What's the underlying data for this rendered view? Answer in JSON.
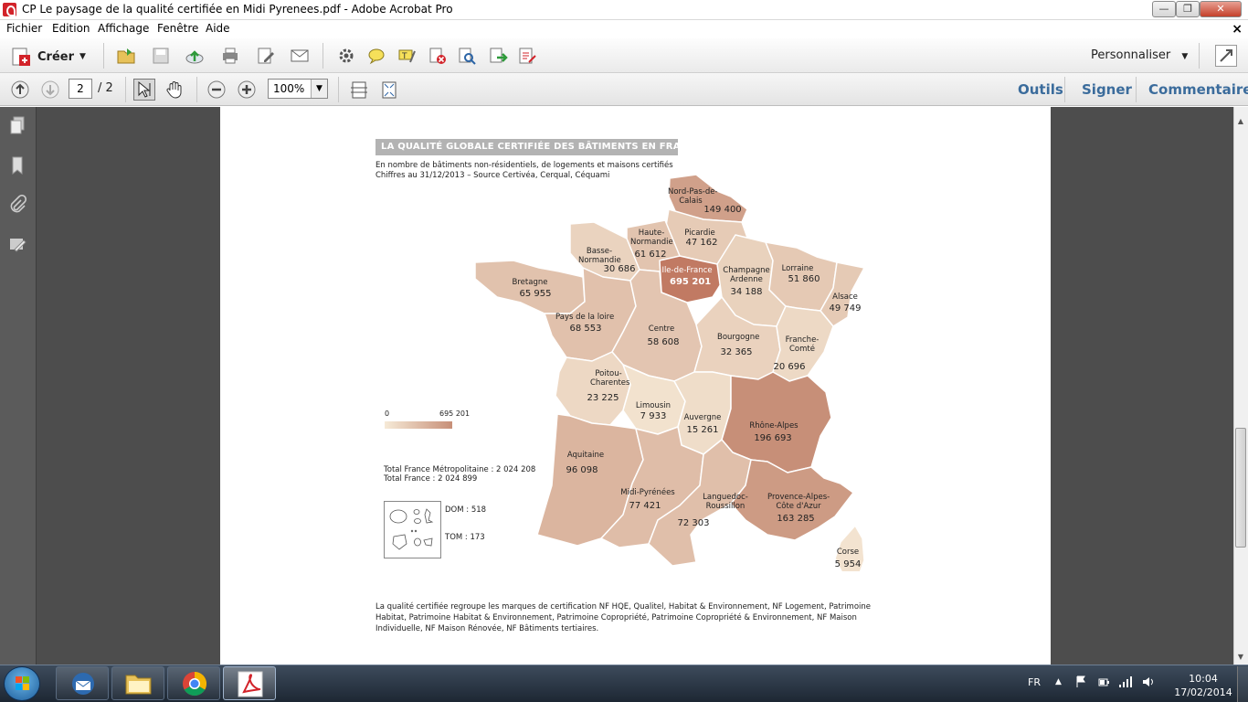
{
  "window": {
    "title": "CP Le paysage de la qualité certifiée en Midi Pyrenees.pdf - Adobe Acrobat Pro",
    "min": "—",
    "max": "❐",
    "close": "✕"
  },
  "menu": [
    "Fichier",
    "Edition",
    "Affichage",
    "Fenêtre",
    "Aide"
  ],
  "doc_close": "×",
  "toolbar": {
    "create_label": "Créer",
    "customize_label": "Personnaliser",
    "page_current": "2",
    "page_total": "/ 2",
    "zoom": "100%",
    "tools": "Outils",
    "sign": "Signer",
    "comment": "Commentaire"
  },
  "map": {
    "title": "LA QUALITÉ GLOBALE CERTIFIÉE DES BÂTIMENTS EN FRANCE",
    "subtitle1": "En nombre de bâtiments non-résidentiels, de logements et maisons certifiés",
    "subtitle2": "Chiffres au 31/12/2013 – Source Certivéa, Cerqual, Céquami",
    "legend_min": "0",
    "legend_max": "695 201",
    "total_metro": "Total France Métropolitaine : 2 024 208",
    "total_france": "Total France  : 2 024 899",
    "dom": "DOM : 518",
    "tom": "TOM : 173",
    "footnote": "La qualité certifiée regroupe les marques de certification NF HQE, Qualitel, Habitat & Environnement, NF Logement, Patrimoine Habitat, Patrimoine Habitat & Environnement, Patrimoine Copropriété, Patrimoine Copropriété & Environnement, NF Maison Individuelle, NF Maison Rénovée, NF Bâtiments tertiaires.",
    "regions": [
      {
        "name": "Nord-Pas-de-Calais",
        "value": 149400
      },
      {
        "name": "Picardie",
        "value": 47162
      },
      {
        "name": "Haute-Normandie",
        "value": 61612
      },
      {
        "name": "Basse-Normandie",
        "value": 30686
      },
      {
        "name": "Ile-de-France",
        "value": 695201
      },
      {
        "name": "Champagne Ardenne",
        "value": 34188
      },
      {
        "name": "Lorraine",
        "value": 51860
      },
      {
        "name": "Alsace",
        "value": 49749
      },
      {
        "name": "Bretagne",
        "value": 65955
      },
      {
        "name": "Pays de la loire",
        "value": 68553
      },
      {
        "name": "Centre",
        "value": 58608
      },
      {
        "name": "Bourgogne",
        "value": 32365
      },
      {
        "name": "Franche-Comté",
        "value": 20696
      },
      {
        "name": "Poitou-Charentes",
        "value": 23225
      },
      {
        "name": "Limousin",
        "value": 7933
      },
      {
        "name": "Auvergne",
        "value": 15261
      },
      {
        "name": "Rhône-Alpes",
        "value": 196693
      },
      {
        "name": "Aquitaine",
        "value": 96098
      },
      {
        "name": "Midi-Pyrénées",
        "value": 77421
      },
      {
        "name": "Languedoc-Roussillon",
        "value": 72303
      },
      {
        "name": "Provence-Alpes-Côte d'Azur",
        "value": 163285
      },
      {
        "name": "Corse",
        "value": 5954
      }
    ]
  },
  "labels": {
    "npdc": {
      "name": "Nord-Pas-de-\nCalais",
      "value": "149 400"
    },
    "picardie": {
      "name": "Picardie",
      "value": "47 162"
    },
    "hnormandie": {
      "name": "Haute-\nNormandie",
      "value": "61 612"
    },
    "bnormandie": {
      "name": "Basse-\nNormandie",
      "value": "30 686"
    },
    "idf": {
      "name": "Ile-de-France",
      "value": "695 201"
    },
    "champagne": {
      "name": "Champagne\nArdenne",
      "value": "34 188"
    },
    "lorraine": {
      "name": "Lorraine",
      "value": "51 860"
    },
    "alsace": {
      "name": "Alsace",
      "value": "49 749"
    },
    "bretagne": {
      "name": "Bretagne",
      "value": "65 955"
    },
    "pdl": {
      "name": "Pays de la loire",
      "value": "68 553"
    },
    "centre": {
      "name": "Centre",
      "value": "58 608"
    },
    "bourgogne": {
      "name": "Bourgogne",
      "value": "32 365"
    },
    "fcomte": {
      "name": "Franche-\nComté",
      "value": "20 696"
    },
    "poitou": {
      "name": "Poitou-\nCharentes",
      "value": "23 225"
    },
    "limousin": {
      "name": "Limousin",
      "value": "7 933"
    },
    "auvergne": {
      "name": "Auvergne",
      "value": "15 261"
    },
    "rhone": {
      "name": "Rhône-Alpes",
      "value": "196 693"
    },
    "aquitaine": {
      "name": "Aquitaine",
      "value": "96 098"
    },
    "midi": {
      "name": "Midi-Pyrénées",
      "value": "77 421"
    },
    "languedoc": {
      "name": "Languedoc-\nRoussillon",
      "value": "72 303"
    },
    "paca": {
      "name": "Provence-Alpes-\nCôte d'Azur",
      "value": "163 285"
    },
    "corse": {
      "name": "Corse",
      "value": "5 954"
    }
  },
  "colors": {
    "low": "#f6ead7",
    "high": "#c78f78",
    "idf": "#c17a63",
    "link": "#3b6c9c"
  },
  "taskbar": {
    "lang": "FR",
    "time": "10:04",
    "date": "17/02/2014",
    "apps": [
      "thunderbird-icon",
      "explorer-icon",
      "chrome-icon",
      "acrobat-icon"
    ]
  }
}
